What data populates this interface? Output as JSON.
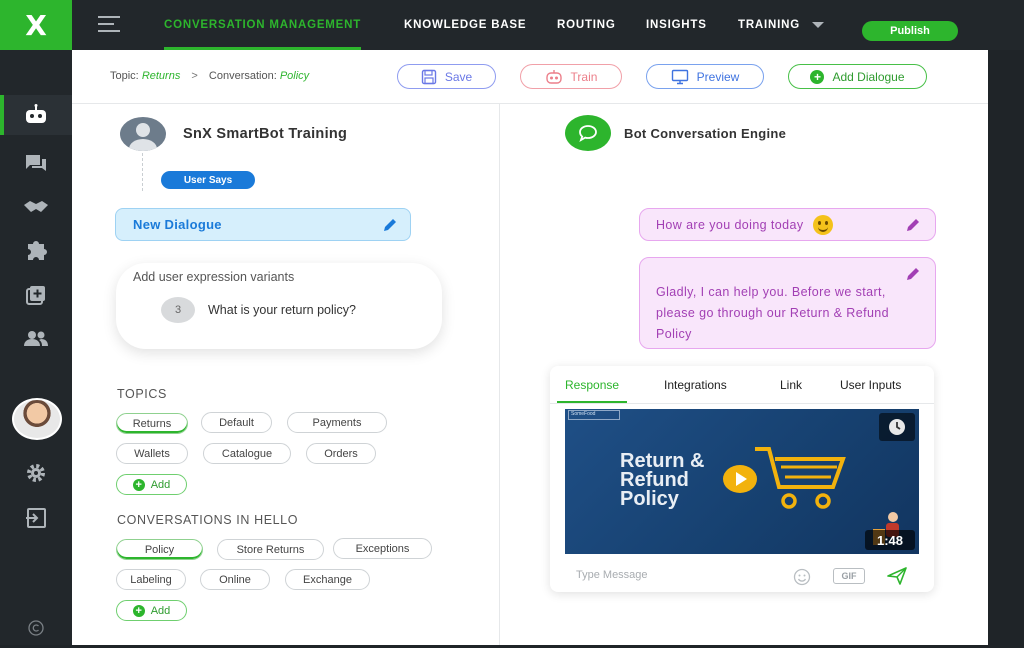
{
  "app": {
    "logo_text": "X",
    "accent": "#2db52d"
  },
  "nav": {
    "tabs": [
      {
        "label": "CONVERSATION MANAGEMENT",
        "active": true
      },
      {
        "label": "KNOWLEDGE BASE"
      },
      {
        "label": "ROUTING"
      },
      {
        "label": "INSIGHTS"
      },
      {
        "label": "TRAINING"
      }
    ],
    "publish": "Publish"
  },
  "sidebar": {
    "icons": [
      "bot-icon",
      "chat-icon",
      "handshake-icon",
      "puzzle-icon",
      "add-box-icon",
      "people-icon",
      "settings-icon",
      "logout-icon",
      "copyright-icon"
    ]
  },
  "breadcrumb": {
    "topic_label": "Topic:",
    "topic_value": "Returns",
    "separator": ">",
    "conversation_label": "Conversation:",
    "conversation_value": "Policy"
  },
  "toolbar": {
    "save": "Save",
    "train": "Train",
    "preview": "Preview",
    "add_dialogue": "Add Dialogue"
  },
  "left": {
    "bot_title": "SnX SmartBot Training",
    "user_says": "User Says",
    "new_dialogue": "New Dialogue",
    "variants_title": "Add user expression variants",
    "variant_count": "3",
    "variant_phrase": "What is your return policy?",
    "topics_label": "TOPICS",
    "topics": [
      "Returns",
      "Default",
      "Payments",
      "Wallets",
      "Catalogue",
      "Orders"
    ],
    "add_label": "Add",
    "conversations_label": "CONVERSATIONS IN HELLO",
    "conversations": [
      "Policy",
      "Store Returns",
      "Exceptions",
      "Labeling",
      "Online",
      "Exchange"
    ]
  },
  "right": {
    "engine_title": "Bot Conversation Engine",
    "question": "How are you doing today",
    "answer": "Gladly, I can help you. Before we start, please go through our Return & Refund Policy",
    "tabs": [
      "Response",
      "Integrations",
      "Link",
      "User Inputs"
    ],
    "video_brand": "SomeFood",
    "video_title_1": "Return &",
    "video_title_2": "Refund",
    "video_title_3": "Policy",
    "video_duration": "1:48",
    "message_placeholder": "Type Message",
    "gif_label": "GIF"
  }
}
